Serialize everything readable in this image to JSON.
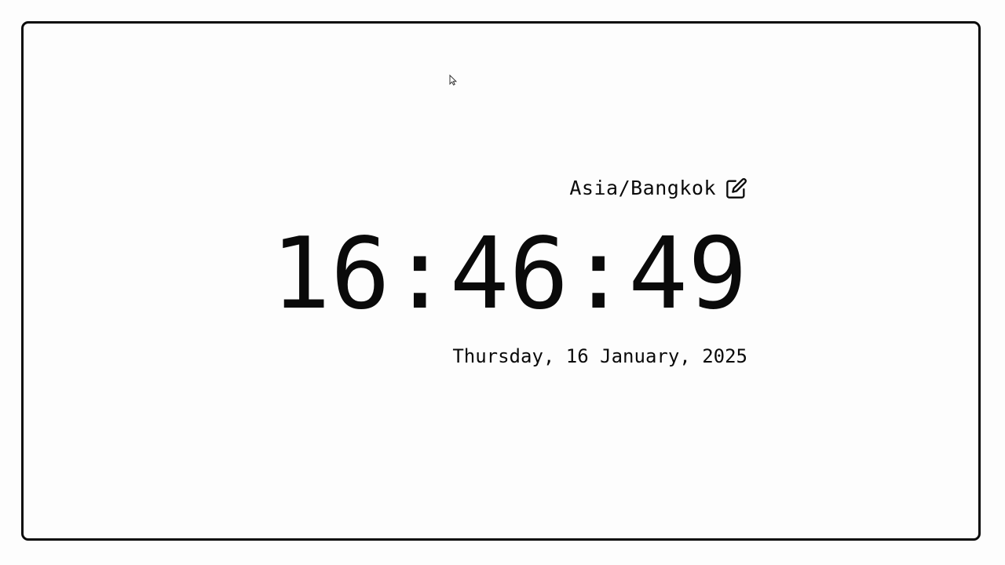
{
  "clock": {
    "timezone": "Asia/Bangkok",
    "time": "16:46:49",
    "date": "Thursday, 16 January, 2025"
  },
  "icons": {
    "edit": "edit-icon",
    "cursor": "mouse-pointer-icon"
  },
  "colors": {
    "foreground": "#0a0a0a",
    "background": "#fdfdfd"
  }
}
